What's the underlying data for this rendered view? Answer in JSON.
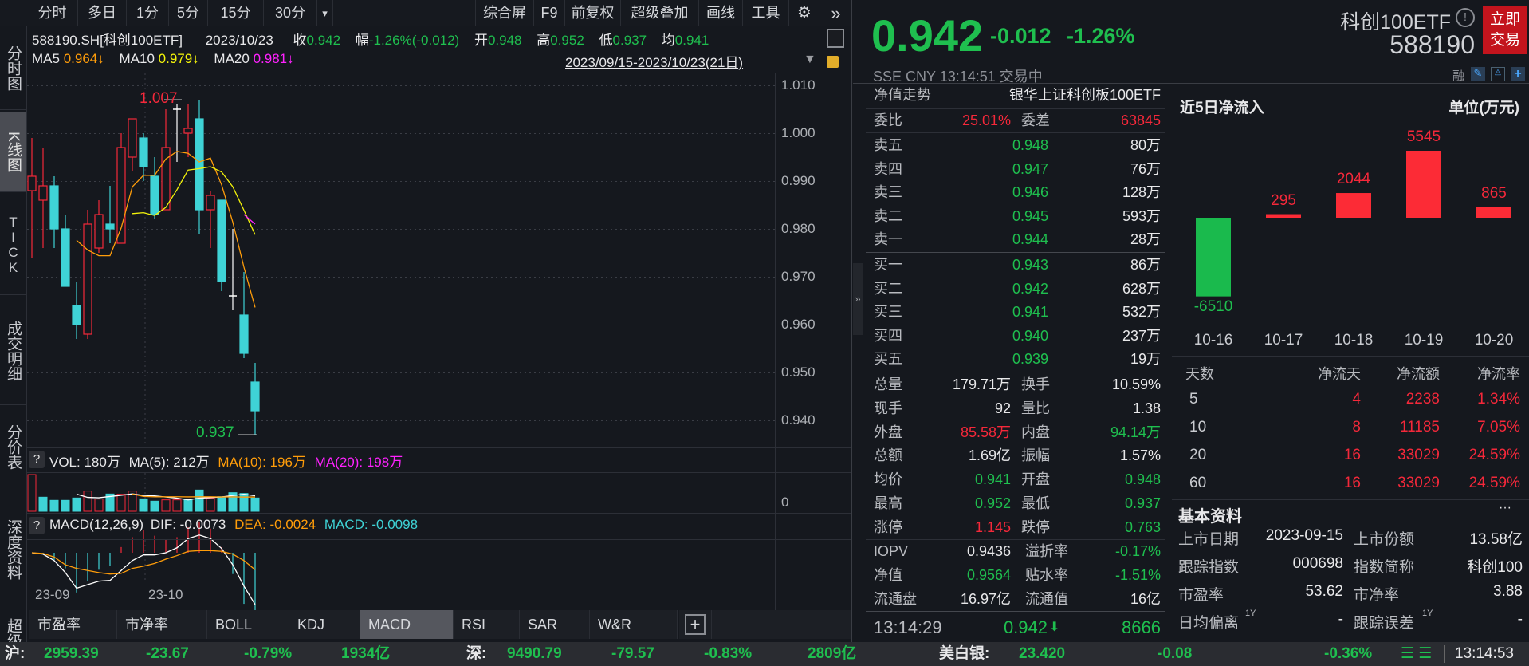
{
  "toolbar": {
    "periods": [
      "分时",
      "多日",
      "1分",
      "5分",
      "15分",
      "30分"
    ],
    "more": "▾",
    "right": [
      "综合屏",
      "F9",
      "前复权",
      "超级叠加",
      "画线",
      "工具"
    ],
    "gear": "⚙",
    "expand": "»"
  },
  "sidebar": [
    "分时图",
    "K线图",
    "TICK",
    "成交明细",
    "分价表",
    "深度资料",
    "超级"
  ],
  "info": {
    "code": "588190.SH[科创100ETF]",
    "date": "2023/10/23",
    "close_label": "收",
    "close": "0.942",
    "range_label": "幅",
    "range": "-1.26%(-0.012)",
    "open_label": "开",
    "open": "0.948",
    "high_label": "高",
    "high": "0.952",
    "low_label": "低",
    "low": "0.937",
    "avg_label": "均",
    "avg": "0.941"
  },
  "ma": {
    "ma5_label": "MA5",
    "ma5": "0.964↓",
    "ma10_label": "MA10",
    "ma10": "0.979↓",
    "ma20_label": "MA20",
    "ma20": "0.981↓",
    "date_range": "2023/09/15-2023/10/23(21日)"
  },
  "kline": {
    "price_ticks": [
      "1.010",
      "1.000",
      "0.990",
      "0.980",
      "0.970",
      "0.960",
      "0.950",
      "0.940"
    ],
    "price_tick_values": [
      1.01,
      1.0,
      0.99,
      0.98,
      0.97,
      0.96,
      0.95,
      0.94
    ],
    "high_marker": "1.007",
    "low_marker": "0.937",
    "candles": [
      {
        "o": 0.988,
        "c": 0.991,
        "h": 0.999,
        "l": 0.974
      },
      {
        "o": 0.986,
        "c": 0.989,
        "h": 0.997,
        "l": 0.976
      },
      {
        "o": 0.989,
        "c": 0.98,
        "h": 0.991,
        "l": 0.976
      },
      {
        "o": 0.98,
        "c": 0.968,
        "h": 0.983,
        "l": 0.968
      },
      {
        "o": 0.964,
        "c": 0.96,
        "h": 0.969,
        "l": 0.957
      },
      {
        "o": 0.958,
        "c": 0.981,
        "h": 0.984,
        "l": 0.957
      },
      {
        "o": 0.976,
        "c": 0.983,
        "h": 0.986,
        "l": 0.975
      },
      {
        "o": 0.981,
        "c": 0.98,
        "h": 0.989,
        "l": 0.977
      },
      {
        "o": 0.977,
        "c": 0.997,
        "h": 1.0,
        "l": 0.977
      },
      {
        "o": 0.995,
        "c": 1.003,
        "h": 1.003,
        "l": 0.992
      },
      {
        "o": 0.999,
        "c": 0.993,
        "h": 1.0,
        "l": 0.99
      },
      {
        "o": 0.991,
        "c": 0.983,
        "h": 0.995,
        "l": 0.982
      },
      {
        "o": 0.984,
        "c": 0.997,
        "h": 1.005,
        "l": 0.984
      },
      {
        "o": 1.005,
        "c": 1.005,
        "h": 1.006,
        "l": 0.994
      },
      {
        "o": 1.0,
        "c": 1.001,
        "h": 1.006,
        "l": 0.995
      },
      {
        "o": 1.003,
        "c": 0.984,
        "h": 1.007,
        "l": 0.979
      },
      {
        "o": 0.984,
        "c": 0.987,
        "h": 0.988,
        "l": 0.976
      },
      {
        "o": 0.986,
        "c": 0.969,
        "h": 0.986,
        "l": 0.967
      },
      {
        "o": 0.966,
        "c": 0.966,
        "h": 0.98,
        "l": 0.963
      },
      {
        "o": 0.962,
        "c": 0.954,
        "h": 0.971,
        "l": 0.953
      },
      {
        "o": 0.948,
        "c": 0.942,
        "h": 0.952,
        "l": 0.937
      }
    ],
    "ma20_tail": [
      0.983,
      0.981
    ],
    "x_labels": [
      "23-09",
      "23-10"
    ]
  },
  "volume": {
    "header": {
      "q": "?",
      "vol": "VOL: 180万",
      "ma5": "MA(5): 212万",
      "ma10": "MA(10): 196万",
      "ma20": "MA(20): 198万"
    },
    "axis_zero": "0",
    "values": [
      497,
      191,
      148,
      148,
      180,
      274,
      166,
      234,
      230,
      274,
      169,
      137,
      155,
      155,
      155,
      288,
      176,
      198,
      252,
      241,
      180
    ],
    "up": [
      true,
      false,
      false,
      false,
      false,
      true,
      true,
      false,
      true,
      true,
      false,
      false,
      true,
      true,
      false,
      false,
      true,
      false,
      false,
      false,
      false
    ]
  },
  "macd": {
    "header": {
      "q": "?",
      "name": "MACD(12,26,9)",
      "dif": "DIF: -0.0073",
      "dea": "DEA: -0.0024",
      "macd": "MACD: -0.0098"
    },
    "dif": [
      0,
      -0.0002,
      -0.0011,
      -0.0028,
      -0.005,
      -0.0045,
      -0.004,
      -0.0039,
      -0.0025,
      -0.0011,
      -0.0003,
      -0.0003,
      0,
      0.0007,
      0.002,
      0.0025,
      0.002,
      0.0006,
      -0.0017,
      -0.0047,
      -0.0073
    ],
    "dea": [
      0,
      -0.0001,
      -0.0006,
      -0.0017,
      -0.0022,
      -0.0025,
      -0.0028,
      -0.003,
      -0.0029,
      -0.0022,
      -0.0019,
      -0.0015,
      -0.0009,
      -0.0004,
      0.0002,
      0.0003,
      0.0003,
      0.0002,
      -0.0002,
      -0.0011,
      -0.0024
    ]
  },
  "indicator_tabs": [
    "市盈率",
    "市净率",
    "BOLL",
    "KDJ",
    "MACD",
    "RSI",
    "SAR",
    "W&R",
    "+"
  ],
  "quote": {
    "price": "0.942",
    "change": "-0.012",
    "pct": "-1.26%",
    "meta": "SSE  CNY  13:14:51  交易中",
    "name": "科创100ETF",
    "code": "588190",
    "trade_btn": [
      "立即",
      "交易"
    ],
    "icons": [
      "融",
      "✎",
      "🔔",
      "+"
    ]
  },
  "book": {
    "nav_label": "净值走势",
    "fund_name": "银华上证科创板100ETF",
    "wb_label": "委比",
    "wb": "25.01%",
    "wc_label": "委差",
    "wc": "63845",
    "asks": [
      {
        "label": "卖五",
        "price": "0.948",
        "vol": "80万"
      },
      {
        "label": "卖四",
        "price": "0.947",
        "vol": "76万"
      },
      {
        "label": "卖三",
        "price": "0.946",
        "vol": "128万"
      },
      {
        "label": "卖二",
        "price": "0.945",
        "vol": "593万"
      },
      {
        "label": "卖一",
        "price": "0.944",
        "vol": "28万"
      }
    ],
    "bids": [
      {
        "label": "买一",
        "price": "0.943",
        "vol": "86万"
      },
      {
        "label": "买二",
        "price": "0.942",
        "vol": "628万"
      },
      {
        "label": "买三",
        "price": "0.941",
        "vol": "532万"
      },
      {
        "label": "买四",
        "price": "0.940",
        "vol": "237万"
      },
      {
        "label": "买五",
        "price": "0.939",
        "vol": "19万"
      }
    ],
    "stats": [
      {
        "l1": "总量",
        "v1": "179.71万",
        "c1": "w",
        "l2": "换手",
        "v2": "10.59%",
        "c2": "w"
      },
      {
        "l1": "现手",
        "v1": "92",
        "c1": "w",
        "l2": "量比",
        "v2": "1.38",
        "c2": "w"
      },
      {
        "l1": "外盘",
        "v1": "85.58万",
        "c1": "r",
        "l2": "内盘",
        "v2": "94.14万",
        "c2": "g"
      },
      {
        "l1": "总额",
        "v1": "1.69亿",
        "c1": "w",
        "l2": "振幅",
        "v2": "1.57%",
        "c2": "w"
      },
      {
        "l1": "均价",
        "v1": "0.941",
        "c1": "g",
        "l2": "开盘",
        "v2": "0.948",
        "c2": "g"
      },
      {
        "l1": "最高",
        "v1": "0.952",
        "c1": "g",
        "l2": "最低",
        "v2": "0.937",
        "c2": "g"
      },
      {
        "l1": "涨停",
        "v1": "1.145",
        "c1": "r",
        "l2": "跌停",
        "v2": "0.763",
        "c2": "g"
      }
    ],
    "etf": [
      {
        "l1": "IOPV",
        "v1": "0.9436",
        "c1": "w",
        "l2": "溢折率",
        "v2": "-0.17%",
        "c2": "g"
      },
      {
        "l1": "净值",
        "v1": "0.9564",
        "c1": "g",
        "l2": "贴水率",
        "v2": "-1.51%",
        "c2": "g"
      },
      {
        "l1": "流通盘",
        "v1": "16.97亿",
        "c1": "w",
        "l2": "流通值",
        "v2": "16亿",
        "c2": "w"
      }
    ],
    "last_tick": {
      "time": "13:14:29",
      "price": "0.942",
      "arrow": "🡇",
      "vol": "8666"
    },
    "collapse": "»"
  },
  "flow": {
    "title": "近5日净流入",
    "unit": "单位(万元)",
    "chart_data": {
      "type": "bar",
      "categories": [
        "10-16",
        "10-17",
        "10-18",
        "10-19",
        "10-20"
      ],
      "values": [
        -6510,
        295,
        2044,
        5545,
        865
      ]
    },
    "labels": [
      "-6510",
      "295",
      "2044",
      "5545",
      "865"
    ],
    "table_headers": [
      "天数",
      "净流天",
      "净流额",
      "净流率"
    ],
    "table": [
      [
        "5",
        "4",
        "2238",
        "1.34%"
      ],
      [
        "10",
        "8",
        "11185",
        "7.05%"
      ],
      [
        "20",
        "16",
        "33029",
        "24.59%"
      ],
      [
        "60",
        "16",
        "33029",
        "24.59%"
      ]
    ]
  },
  "basic": {
    "title": "基本资料",
    "more": "···",
    "rows": [
      {
        "l1": "上市日期",
        "v1": "2023-09-15",
        "l2": "上市份额",
        "v2": "13.58亿"
      },
      {
        "l1": "跟踪指数",
        "v1": "000698",
        "l2": "指数简称",
        "v2": "科创100"
      },
      {
        "l1": "市盈率",
        "v1": "53.62",
        "l2": "市净率",
        "v2": "3.88"
      },
      {
        "l1": "日均偏离",
        "s1": "1Y",
        "v1": "-",
        "l2": "跟踪误差",
        "s2": "1Y",
        "v2": "-"
      }
    ]
  },
  "status": {
    "sh_label": "沪:",
    "sh": "2959.39",
    "sh_chg": "-23.67",
    "sh_pct": "-0.79%",
    "sh_amt": "1934亿",
    "sz_label": "深:",
    "sz": "9490.79",
    "sz_chg": "-79.57",
    "sz_pct": "-0.83%",
    "sz_amt": "2809亿",
    "ag_label": "美白银:",
    "ag": "23.420",
    "ag_chg": "-0.08",
    "ag_pct": "-0.36%",
    "time": "13:14:53"
  },
  "colors": {
    "up": "#f5283a",
    "down": "#3fd3d6",
    "green": "#1fbf4f",
    "ma5": "#ff9d0a",
    "ma10": "#f4f40a",
    "ma20": "#ff22ff"
  }
}
